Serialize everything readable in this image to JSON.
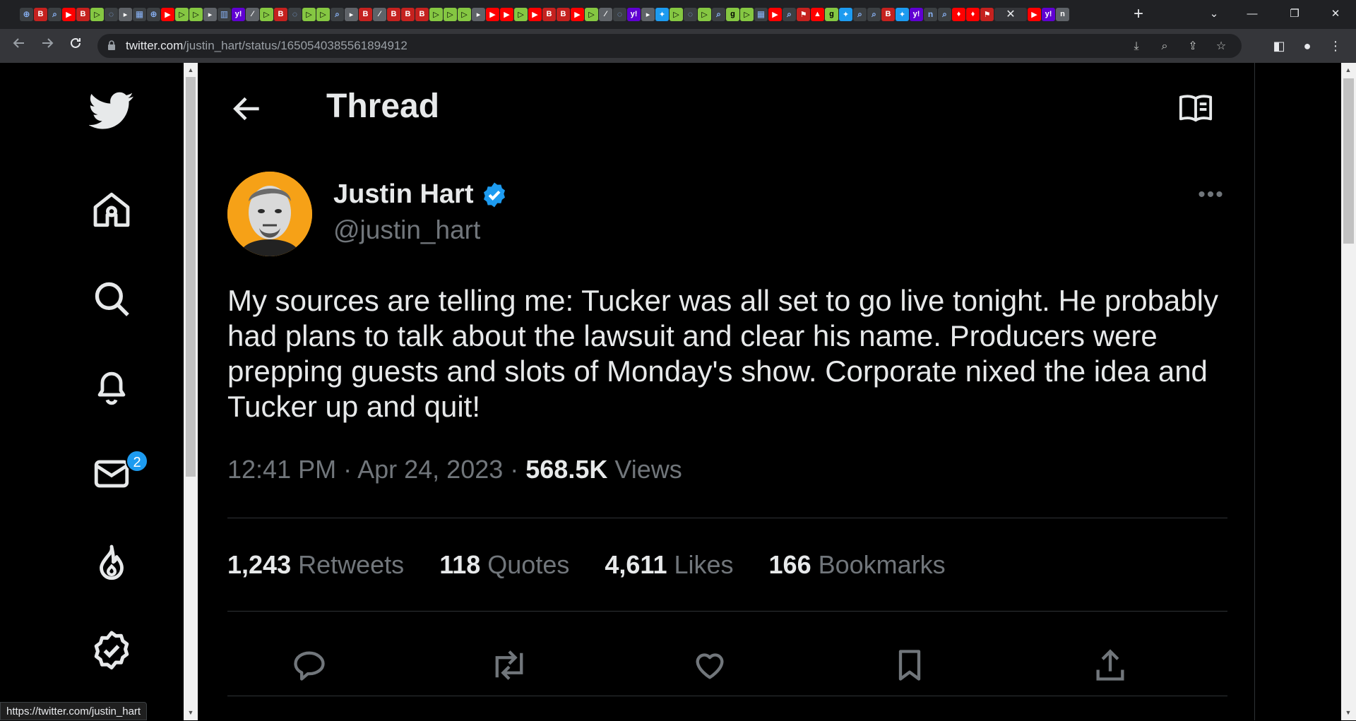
{
  "browser": {
    "url_host": "twitter.com",
    "url_path": "/justin_hart/status/1650540385561894912",
    "status_url": "https://twitter.com/justin_hart",
    "new_tab_label": "+",
    "active_tab_close": "✕",
    "window_controls": {
      "dropdown": "⌄",
      "minimize": "—",
      "restore": "❐",
      "close": "✕"
    }
  },
  "nav": {
    "items": [
      {
        "name": "home",
        "icon": "home-icon"
      },
      {
        "name": "explore",
        "icon": "search-icon"
      },
      {
        "name": "notifications",
        "icon": "bell-icon"
      },
      {
        "name": "messages",
        "icon": "mail-icon",
        "badge": "2"
      },
      {
        "name": "trending",
        "icon": "flame-icon"
      },
      {
        "name": "verified",
        "icon": "verified-icon"
      }
    ],
    "messages_badge": "2"
  },
  "header": {
    "title": "Thread"
  },
  "tweet": {
    "author_name": "Justin Hart",
    "handle": "@justin_hart",
    "more": "•••",
    "text": "My sources are telling me: Tucker was all set to go live tonight. He probably had plans to talk about the lawsuit and clear his name. Producers were prepping guests and slots of Monday's show. Corporate nixed the idea and Tucker up and quit!",
    "time": "12:41 PM",
    "date": "Apr 24, 2023",
    "separator": " · ",
    "views_count": "568.5K",
    "views_label": "Views",
    "stats": {
      "retweets_count": "1,243",
      "retweets_label": "Retweets",
      "quotes_count": "118",
      "quotes_label": "Quotes",
      "likes_count": "4,611",
      "likes_label": "Likes",
      "bookmarks_count": "166",
      "bookmarks_label": "Bookmarks"
    }
  },
  "colors": {
    "background": "#000000",
    "text": "#e7e9ea",
    "muted": "#71767b",
    "accent": "#1d9bf0",
    "avatar_bg": "#f6a117",
    "chrome_dark": "#202124",
    "chrome_toolbar": "#35363a"
  }
}
